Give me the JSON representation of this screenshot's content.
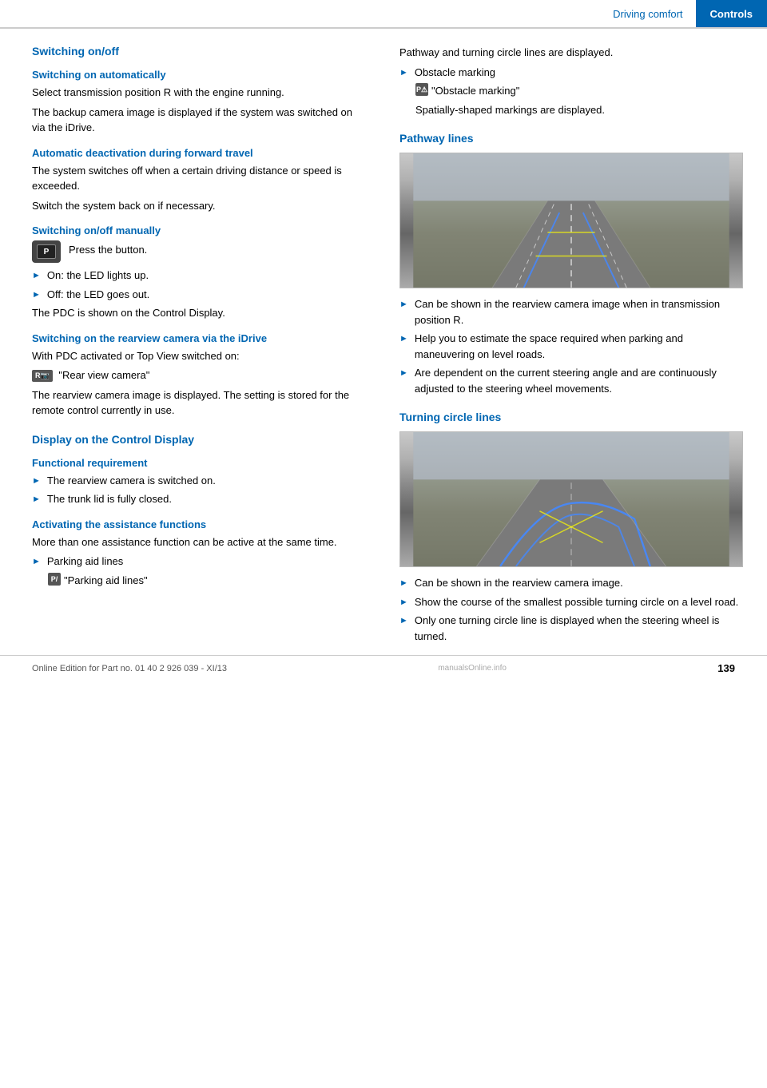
{
  "header": {
    "driving_comfort": "Driving comfort",
    "controls": "Controls"
  },
  "left_column": {
    "main_title": "Switching on/off",
    "sections": [
      {
        "id": "switching-on-automatically",
        "title": "Switching on automatically",
        "paragraphs": [
          "Select transmission position R with the engine running.",
          "The backup camera image is displayed if the system was switched on via the iDrive."
        ]
      },
      {
        "id": "automatic-deactivation",
        "title": "Automatic deactivation during forward travel",
        "paragraphs": [
          "The system switches off when a certain driving distance or speed is exceeded.",
          "Switch the system back on if necessary."
        ]
      },
      {
        "id": "switching-onoff-manually",
        "title": "Switching on/off manually",
        "button_text": "Press the button.",
        "bullets": [
          "On: the LED lights up.",
          "Off: the LED goes out."
        ],
        "pdc_text": "The PDC is shown on the Control Display."
      },
      {
        "id": "switching-rearview-camera",
        "title": "Switching on the rearview camera via the iDrive",
        "paragraphs": [
          "With PDC activated or Top View switched on:",
          "\"Rear view camera\"",
          "The rearview camera image is displayed. The setting is stored for the remote control currently in use."
        ]
      },
      {
        "id": "display-control",
        "title": "Display on the Control Display",
        "bold": true
      },
      {
        "id": "functional-requirement",
        "title": "Functional requirement",
        "bullets": [
          "The rearview camera is switched on.",
          "The trunk lid is fully closed."
        ]
      },
      {
        "id": "activating-assistance",
        "title": "Activating the assistance functions",
        "paragraphs": [
          "More than one assistance function can be active at the same time."
        ],
        "sub_bullets": [
          {
            "label": "Parking aid lines",
            "icon_text": "\"Parking aid lines\""
          }
        ]
      }
    ]
  },
  "right_column": {
    "sections": [
      {
        "id": "pathway-lines-intro",
        "paragraphs": [
          "Pathway and turning circle lines are displayed."
        ],
        "bullets": [
          {
            "text": "Obstacle marking",
            "sub": "\"Obstacle marking\"",
            "sub_text": "Spatially-shaped markings are displayed."
          }
        ]
      },
      {
        "id": "pathway-lines",
        "title": "Pathway lines",
        "bullets": [
          "Can be shown in the rearview camera image when in transmission position R.",
          "Help you to estimate the space required when parking and maneuvering on level roads.",
          "Are dependent on the current steering angle and are continuously adjusted to the steering wheel movements."
        ]
      },
      {
        "id": "turning-circle-lines",
        "title": "Turning circle lines",
        "bullets": [
          "Can be shown in the rearview camera image.",
          "Show the course of the smallest possible turning circle on a level road.",
          "Only one turning circle line is displayed when the steering wheel is turned."
        ]
      }
    ]
  },
  "footer": {
    "edition_text": "Online Edition for Part no. 01 40 2 926 039 - XI/13",
    "page_number": "139",
    "watermark": "manualsOnline.info"
  }
}
